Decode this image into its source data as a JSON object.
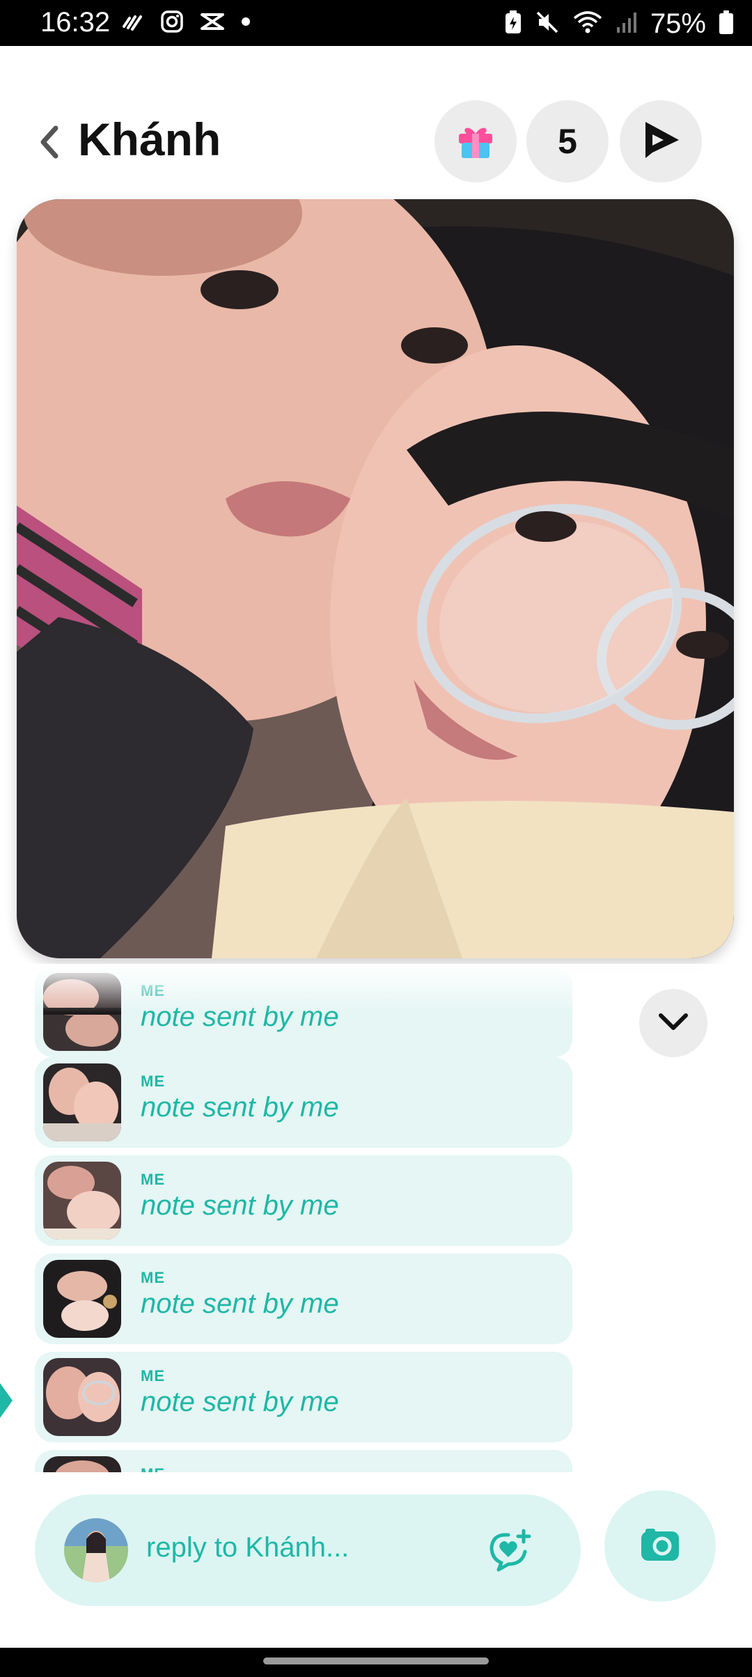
{
  "status_bar": {
    "time": "16:32",
    "battery": "75%",
    "left_icons": [
      "activity-icon",
      "instagram-icon",
      "capcut-icon",
      "dot-icon"
    ],
    "right_icons": [
      "battery-saver-icon",
      "mute-icon",
      "wifi-icon",
      "signal-icon",
      "battery-icon"
    ]
  },
  "header": {
    "title": "Khánh",
    "count": "5",
    "icons": [
      "back-icon",
      "gift-icon",
      "play-icon"
    ]
  },
  "notes": {
    "items": [
      {
        "author": "ME",
        "text": "note sent by me"
      },
      {
        "author": "ME",
        "text": "note sent by me"
      },
      {
        "author": "ME",
        "text": "note sent by me"
      },
      {
        "author": "ME",
        "text": "note sent by me"
      },
      {
        "author": "ME",
        "text": "note sent by me"
      },
      {
        "author": "ME",
        "text": ""
      }
    ]
  },
  "reply": {
    "placeholder": "reply to Khánh..."
  },
  "colors": {
    "accent": "#1fb7a6",
    "note_bg": "#e5f6f4",
    "reply_bg": "#dcf5f2"
  }
}
